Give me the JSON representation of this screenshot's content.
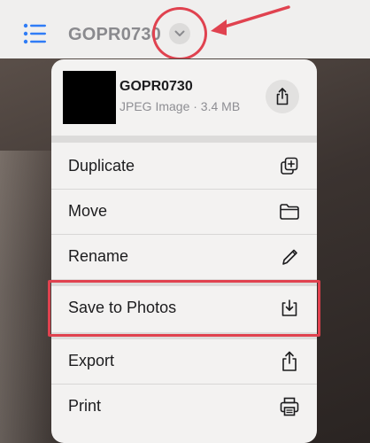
{
  "header": {
    "title": "GOPR0730"
  },
  "file": {
    "name": "GOPR0730",
    "meta": "JPEG Image · 3.4 MB"
  },
  "menu": {
    "items": [
      {
        "label": "Duplicate",
        "icon": "duplicate-icon"
      },
      {
        "label": "Move",
        "icon": "folder-icon"
      },
      {
        "label": "Rename",
        "icon": "pencil-icon"
      },
      {
        "label": "Save to Photos",
        "icon": "save-download-icon"
      },
      {
        "label": "Export",
        "icon": "share-icon"
      },
      {
        "label": "Print",
        "icon": "printer-icon"
      }
    ]
  },
  "colors": {
    "annotation": "#e0424f",
    "accent": "#2f7cf6"
  }
}
